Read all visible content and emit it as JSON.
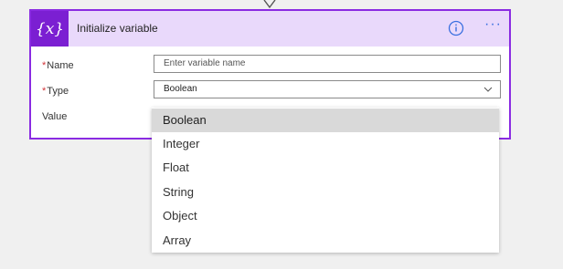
{
  "card": {
    "icon_text": "{x}",
    "title": "Initialize variable",
    "info_icon": "info-icon",
    "more_icon": "more-icon",
    "more_text": "···"
  },
  "fields": {
    "name_label": "Name",
    "name_placeholder": "Enter variable name",
    "type_label": "Type",
    "type_value": "Boolean",
    "value_label": "Value",
    "required_mark": "*"
  },
  "dropdown": {
    "options": [
      "Boolean",
      "Integer",
      "Float",
      "String",
      "Object",
      "Array"
    ],
    "selected": "Boolean"
  },
  "colors": {
    "accent": "#7b1fd2",
    "header_bg": "#e9d9fb",
    "border": "#8a2be2",
    "link": "#3a6fe0"
  }
}
